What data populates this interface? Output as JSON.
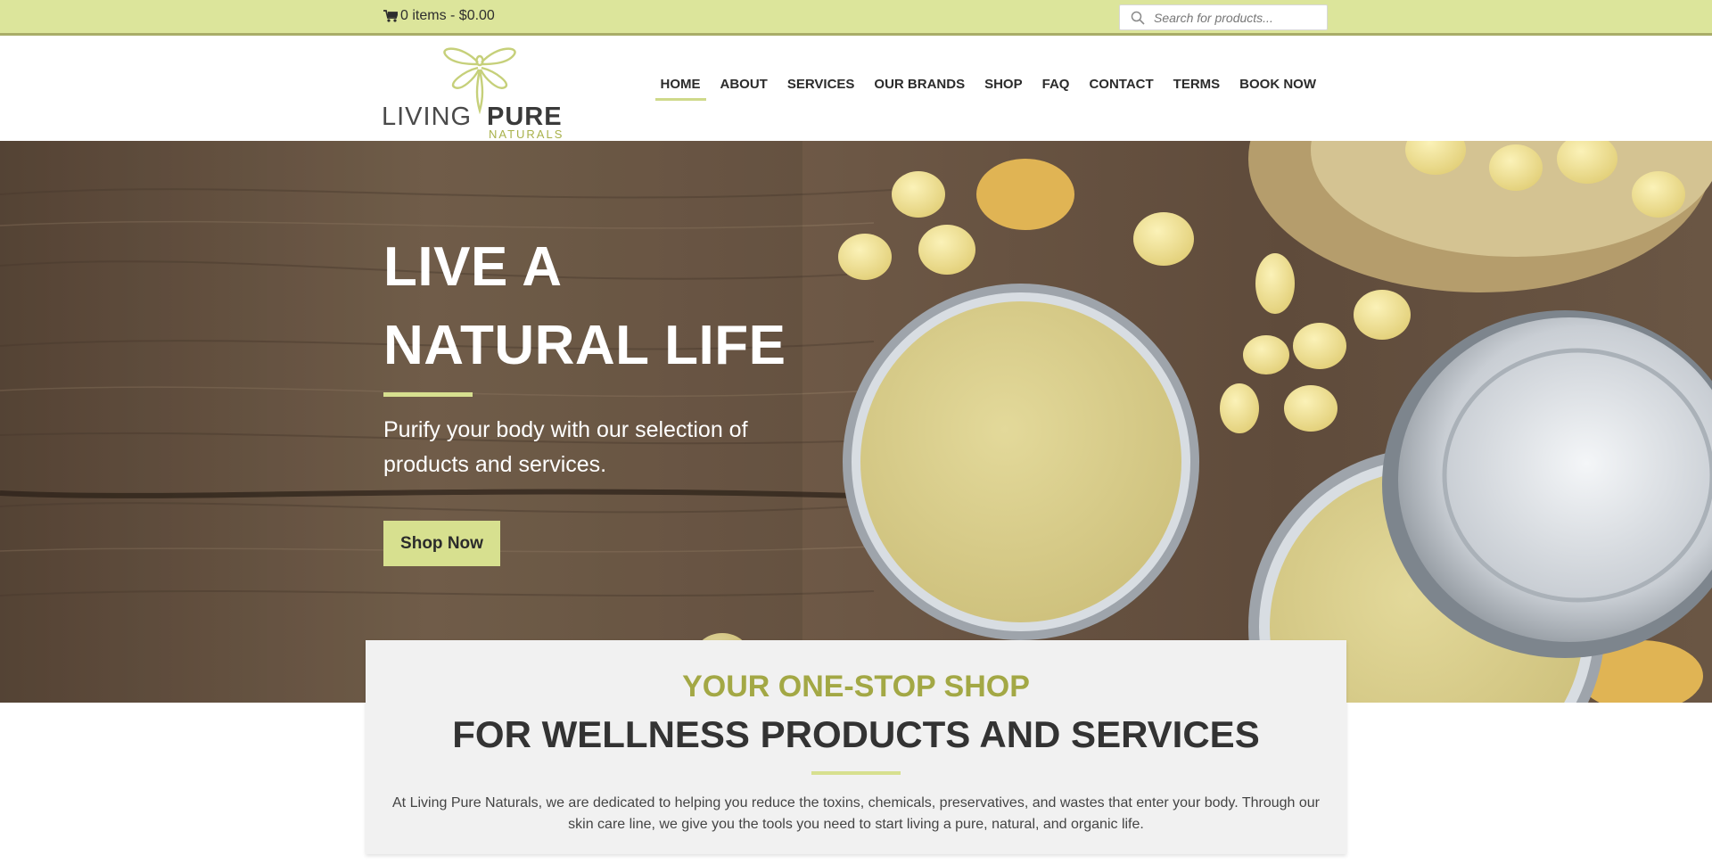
{
  "colors": {
    "accent": "#d7e08f",
    "topbar": "#dce59b",
    "kicker_olive": "#a3a845",
    "card_bg": "#f1f1f1"
  },
  "topbar": {
    "cart_icon": "shopping-cart-icon",
    "cart_text": "0 items - $0.00",
    "search_icon": "search-icon",
    "search_placeholder": "Search for products..."
  },
  "logo": {
    "mark_icon": "dragonfly-logo-icon",
    "living": "LIVING",
    "pure": "PURE",
    "naturals": "NATURALS"
  },
  "nav": {
    "home": "HOME",
    "about": "ABOUT",
    "services": "SERVICES",
    "our_brands": "OUR BRANDS",
    "shop": "SHOP",
    "faq": "FAQ",
    "contact": "CONTACT",
    "terms": "TERMS",
    "book_now": "BOOK NOW",
    "active": "HOME"
  },
  "hero": {
    "title_line1": "LIVE A",
    "title_line2": "NATURAL LIFE",
    "subtitle": "Purify your body with our selection of products and services.",
    "cta": "Shop Now"
  },
  "intro": {
    "kicker": "YOUR ONE-STOP SHOP",
    "headline": "FOR WELLNESS PRODUCTS AND SERVICES",
    "body": "At Living Pure Naturals, we are dedicated to helping you reduce the toxins, chemicals, preservatives, and wastes that enter your body. Through our skin care line, we give you the tools you need to start living a pure, natural, and organic life."
  }
}
